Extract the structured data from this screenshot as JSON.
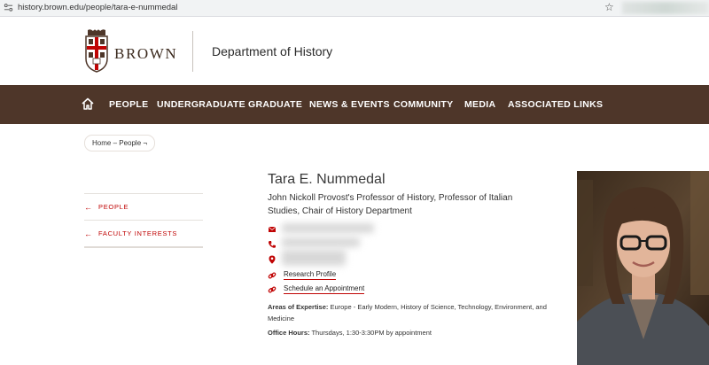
{
  "browser": {
    "url": "history.brown.edu/people/tara-e-nummedal"
  },
  "header": {
    "logo_text": "BROWN",
    "department": "Department of History"
  },
  "nav": {
    "items": [
      "PEOPLE",
      "UNDERGRADUATE",
      "GRADUATE",
      "NEWS & EVENTS",
      "COMMUNITY",
      "MEDIA",
      "ASSOCIATED LINKS"
    ]
  },
  "breadcrumb": "Home – People ¬",
  "sidebar": {
    "items": [
      "PEOPLE",
      "FACULTY INTERESTS"
    ]
  },
  "profile": {
    "name": "Tara E. Nummedal",
    "title": "John Nickoll Provost's Professor of History, Professor of Italian Studies, Chair of History Department",
    "links": [
      "Research Profile",
      "Schedule an Appointment"
    ],
    "expertise_label": "Areas of Expertise:",
    "expertise_value": "Europe - Early Modern, History of Science, Technology, Environment, and Medicine",
    "office_label": "Office Hours:",
    "office_value": "Thursdays, 1:30-3:30PM by appointment"
  },
  "colors": {
    "brand_brown": "#4e3629",
    "accent_red": "#c00404"
  }
}
